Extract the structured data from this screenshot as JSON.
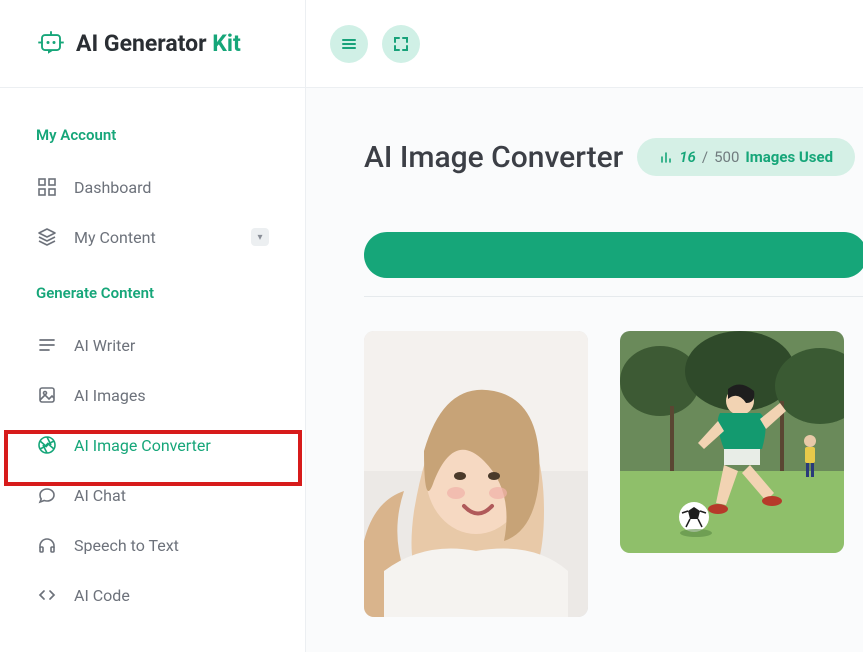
{
  "brand": {
    "name_a": "AI Generator ",
    "name_b": "Kit"
  },
  "sidebar": {
    "sections": [
      {
        "label": "My Account",
        "items": [
          {
            "label": "Dashboard"
          },
          {
            "label": "My Content"
          }
        ]
      },
      {
        "label": "Generate Content",
        "items": [
          {
            "label": "AI Writer"
          },
          {
            "label": "AI Images"
          },
          {
            "label": "AI Image Converter"
          },
          {
            "label": "AI Chat"
          },
          {
            "label": "Speech to Text"
          },
          {
            "label": "AI Code"
          }
        ]
      }
    ]
  },
  "page": {
    "title": "AI Image Converter",
    "usage": {
      "used": "16",
      "sep": "/",
      "total": "500",
      "label": "Images Used"
    }
  }
}
